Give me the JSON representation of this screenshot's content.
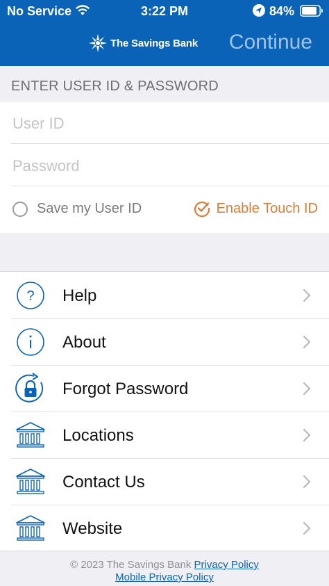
{
  "status_bar": {
    "carrier": "No Service",
    "time": "3:22 PM",
    "battery": "84%"
  },
  "header": {
    "brand": "The Savings Bank",
    "continue_label": "Continue",
    "background": "#0a63b6"
  },
  "login": {
    "section_title": "ENTER USER ID & PASSWORD",
    "user_id_placeholder": "User ID",
    "password_placeholder": "Password",
    "save_user_id_label": "Save my User ID",
    "touch_id_label": "Enable Touch ID",
    "touch_id_color": "#e07b35"
  },
  "menu": {
    "items": [
      {
        "label": "Help",
        "icon": "question-icon"
      },
      {
        "label": "About",
        "icon": "info-icon"
      },
      {
        "label": "Forgot Password",
        "icon": "lock-refresh-icon"
      },
      {
        "label": "Locations",
        "icon": "bank-icon"
      },
      {
        "label": "Contact Us",
        "icon": "bank-icon"
      },
      {
        "label": "Website",
        "icon": "bank-icon"
      }
    ]
  },
  "footer": {
    "copyright": "© 2023 The Savings Bank",
    "privacy_policy": "Privacy Policy",
    "mobile_privacy_policy": "Mobile Privacy Policy"
  }
}
